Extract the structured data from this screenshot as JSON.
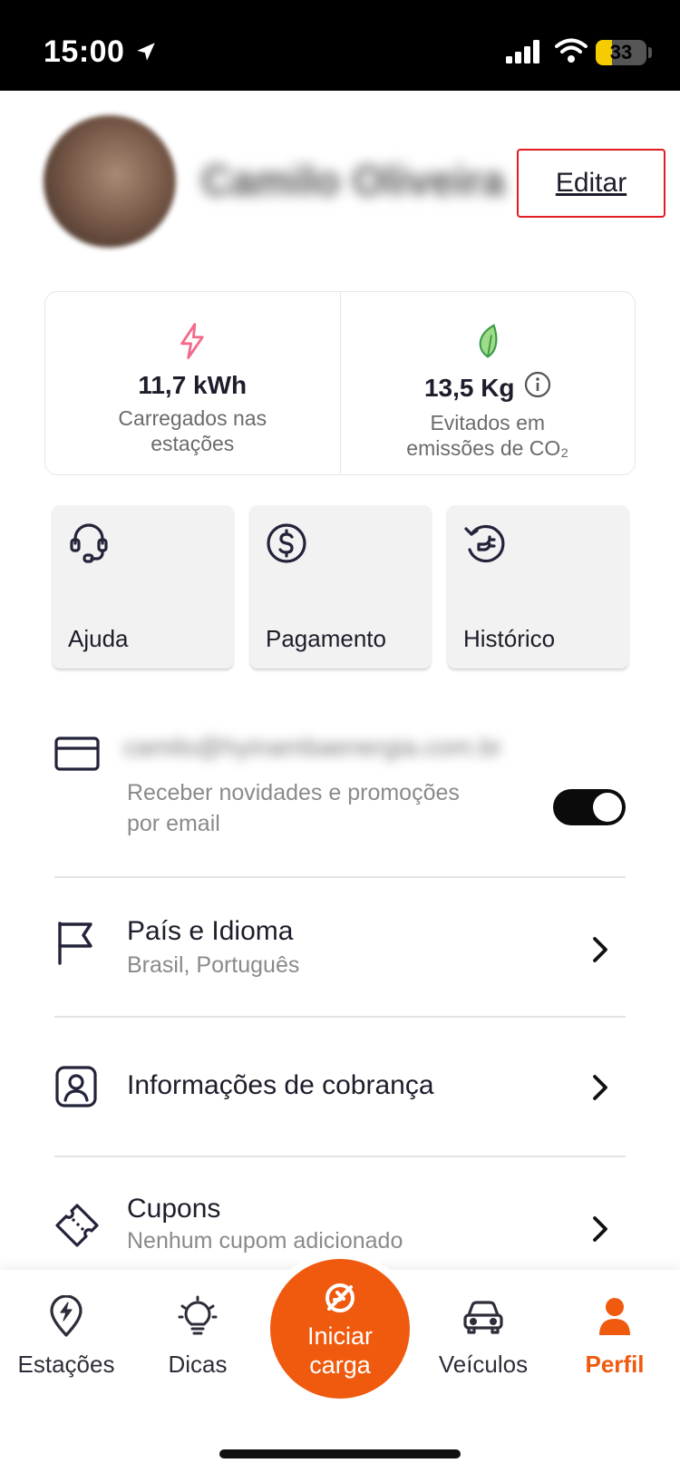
{
  "status_bar": {
    "time": "15:00",
    "battery": "33",
    "battery_level": 0.33
  },
  "profile": {
    "name": "Camilo Oliveira",
    "edit_label": "Editar"
  },
  "stats": [
    {
      "icon": "lightning-icon",
      "value": "11,7 kWh",
      "label": "Carregados nas estações"
    },
    {
      "icon": "leaf-icon",
      "value": "13,5 Kg",
      "label": "Evitados em emissões de CO₂"
    }
  ],
  "tiles": [
    {
      "icon": "headset-icon",
      "label": "Ajuda"
    },
    {
      "icon": "dollar-coin-icon",
      "label": "Pagamento"
    },
    {
      "icon": "history-plug-icon",
      "label": "Histórico"
    }
  ],
  "email_row": {
    "email": "camilo@hyinambaenergia.com.br",
    "line1": "Receber novidades e promoções",
    "line2": "por email",
    "toggle_on": true
  },
  "menu": [
    {
      "icon": "flag-icon",
      "label": "País e Idioma",
      "sub": "Brasil, Português"
    },
    {
      "icon": "user-card-icon",
      "label": "Informações de cobrança",
      "sub": ""
    },
    {
      "icon": "ticket-icon",
      "label": "Cupons",
      "sub": "Nenhum cupom adicionado"
    }
  ],
  "tabbar": {
    "stations": "Estações",
    "tips": "Dicas",
    "start_line1": "Iniciar",
    "start_line2": "carga",
    "vehicles": "Veículos",
    "profile": "Perfil"
  },
  "colors": {
    "accent": "#f05a0e",
    "highlight_box": "#e11b22",
    "text": "#1d1d2b"
  }
}
